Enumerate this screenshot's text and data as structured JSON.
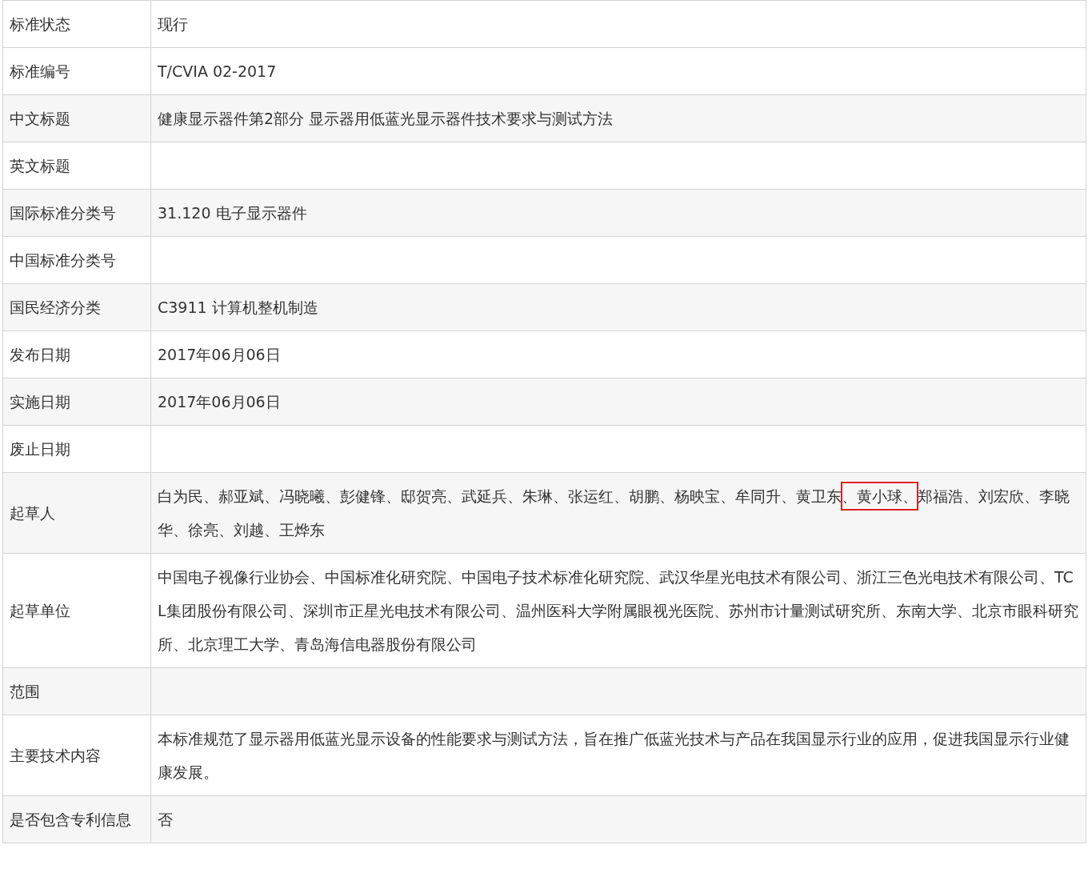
{
  "rows": [
    {
      "label": "标准状态",
      "value": "现行"
    },
    {
      "label": "标准编号",
      "value": "T/CVIA 02-2017"
    },
    {
      "label": "中文标题",
      "value": "健康显示器件第2部分 显示器用低蓝光显示器件技术要求与测试方法"
    },
    {
      "label": "英文标题"
    },
    {
      "label": "国际标准分类号",
      "value": "31.120 电子显示器件"
    },
    {
      "label": "中国标准分类号"
    },
    {
      "label": "国民经济分类",
      "value": "C3911 计算机整机制造"
    },
    {
      "label": "发布日期",
      "value": "2017年06月06日"
    },
    {
      "label": "实施日期",
      "value": "2017年06月06日"
    },
    {
      "label": "废止日期"
    },
    {
      "label": "起草人",
      "segments": [
        {
          "text": "白为民、郝亚斌、冯晓曦、彭健锋、邸贺亮、武延兵、朱琳、张运红、胡鹏、杨映宝、牟同升、黄卫东",
          "highlighted": false
        },
        {
          "text": "、黄小球、",
          "highlighted": true
        },
        {
          "text": "郑福浩、刘宏欣、李晓华、徐亮、刘越、王烨东",
          "highlighted": false
        }
      ]
    },
    {
      "label": "起草单位",
      "value": "中国电子视像行业协会、中国标准化研究院、中国电子技术标准化研究院、武汉华星光电技术有限公司、浙江三色光电技术有限公司、TCL集团股份有限公司、深圳市正星光电技术有限公司、温州医科大学附属眼视光医院、苏州市计量测试研究所、东南大学、北京市眼科研究所、北京理工大学、青岛海信电器股份有限公司"
    },
    {
      "label": "范围"
    },
    {
      "label": "主要技术内容",
      "value": "本标准规范了显示器用低蓝光显示设备的性能要求与测试方法，旨在推广低蓝光技术与产品在我国显示行业的应用，促进我国显示行业健康发展。"
    },
    {
      "label": "是否包含专利信息",
      "value": "否"
    }
  ]
}
